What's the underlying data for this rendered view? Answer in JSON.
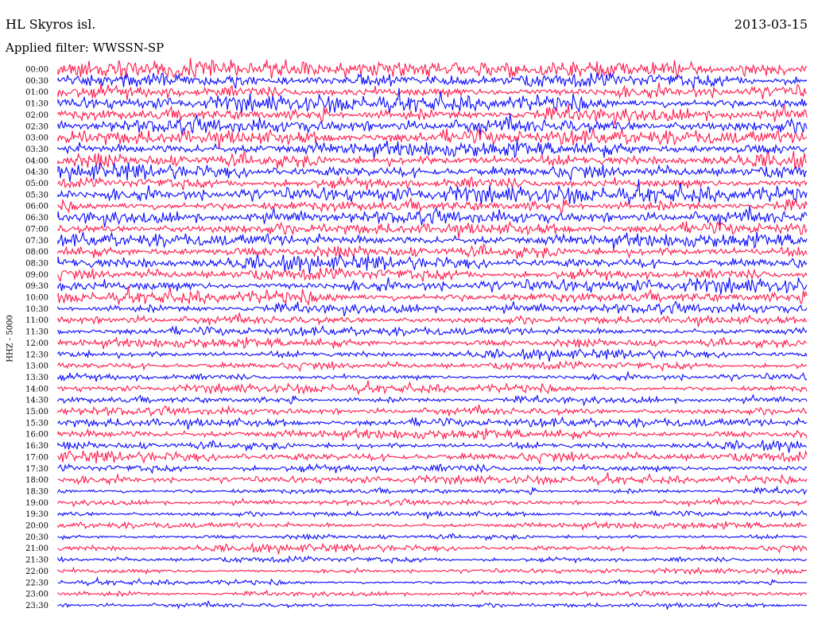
{
  "header": {
    "station": "HL Skyros isl.",
    "date": "2013-03-15",
    "filter": "Applied filter: WWSSN-SP",
    "channel": "HHZ - 5000"
  },
  "colors": {
    "trace_a": "#ff1a4b",
    "trace_b": "#0a0aff",
    "background": "#ffffff"
  },
  "chart_data": {
    "type": "line",
    "title": "HL Skyros isl.",
    "ylabel": "HHZ - 5000",
    "row_labels": [
      "00:00",
      "00:30",
      "01:00",
      "01:30",
      "02:00",
      "02:30",
      "03:00",
      "03:30",
      "04:00",
      "04:30",
      "05:00",
      "05:30",
      "06:00",
      "06:30",
      "07:00",
      "07:30",
      "08:00",
      "08:30",
      "09:00",
      "09:30",
      "10:00",
      "10:30",
      "11:00",
      "11:30",
      "12:00",
      "12:30",
      "13:00",
      "13:30",
      "14:00",
      "14:30",
      "15:00",
      "15:30",
      "16:00",
      "16:30",
      "17:00",
      "17:30",
      "18:00",
      "18:30",
      "19:00",
      "19:30",
      "20:00",
      "20:30",
      "21:00",
      "21:30",
      "22:00",
      "22:30",
      "23:00",
      "23:30"
    ],
    "row_colors": "alternating red / blue per 30-minute line",
    "relative_amplitude": [
      1.0,
      1.0,
      0.95,
      0.95,
      0.95,
      0.95,
      0.95,
      0.95,
      0.95,
      0.95,
      0.95,
      0.95,
      0.85,
      0.85,
      0.8,
      0.85,
      0.85,
      0.85,
      0.85,
      0.85,
      0.8,
      0.65,
      0.55,
      0.55,
      0.6,
      0.55,
      0.55,
      0.5,
      0.5,
      0.45,
      0.5,
      0.55,
      0.6,
      0.55,
      0.7,
      0.65,
      0.45,
      0.4,
      0.35,
      0.35,
      0.4,
      0.35,
      0.45,
      0.4,
      0.3,
      0.3,
      0.3,
      0.3
    ],
    "grid": false,
    "legend": "none"
  }
}
